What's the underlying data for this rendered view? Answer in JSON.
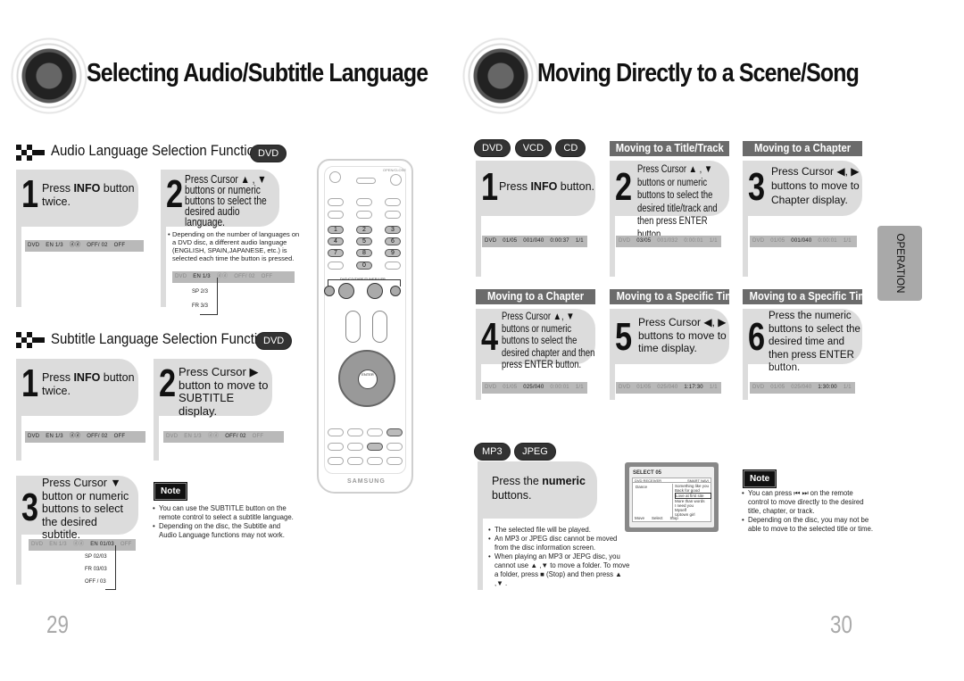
{
  "left_page": {
    "title": "Selecting Audio/Subtitle Language",
    "audio_section": {
      "heading": "Audio Language Selection Function",
      "badge": "DVD",
      "step1": {
        "num": "1",
        "pre": "Press ",
        "bold": "INFO",
        "post": " button twice."
      },
      "step2": {
        "num": "2",
        "text": "Press Cursor ▲ , ▼ buttons or numeric buttons to select the desired audio language."
      },
      "note": "Depending on the number of languages on a DVD disc, a different audio language (ENGLISH, SPAIN,JAPANESE, etc.) is selected each time the button is pressed.",
      "osd1": [
        "DVD",
        "EN 1/3",
        "ⓓⓓ",
        "OFF/ 02",
        "OFF"
      ],
      "osd2": [
        "DVD",
        "EN 1/3",
        "ⓓⓓ",
        "OFF/ 02",
        "OFF"
      ],
      "cycle": [
        "SP 2/3",
        "FR 3/3"
      ]
    },
    "subtitle_section": {
      "heading": "Subtitle Language Selection Function",
      "badge": "DVD",
      "step1": {
        "num": "1",
        "pre": "Press ",
        "bold": "INFO",
        "post": " button twice."
      },
      "step2": {
        "num": "2",
        "text": "Press Cursor ▶ button to move to SUBTITLE display."
      },
      "step3": {
        "num": "3",
        "text": "Press Cursor ▼ button or numeric buttons to select the desired subtitle."
      },
      "osd1": [
        "DVD",
        "EN 1/3",
        "ⓓⓓ",
        "OFF/ 02",
        "OFF"
      ],
      "osd2": [
        "DVD",
        "EN 1/3",
        "ⓓⓓ",
        "OFF/ 02",
        "OFF"
      ],
      "osd3": [
        "DVD",
        "EN 1/3",
        "ⓓⓓ",
        "EN 01/03",
        "OFF"
      ],
      "cycle": [
        "SP 02/03",
        "FR 03/03",
        "OFF / 03"
      ]
    },
    "note": {
      "label": "Note",
      "items": [
        "You can use the SUBTITLE button on the remote control to select a subtitle language.",
        "Depending on the disc, the Subtitle and Audio Language functions may not work."
      ]
    },
    "remote": {
      "brand": "SAMSUNG",
      "keys": [
        "1",
        "2",
        "3",
        "4",
        "5",
        "6",
        "7",
        "8",
        "9",
        "0"
      ],
      "label_top": "OPEN/CLOSE",
      "label_strip": "DVD/CD/TAPE/TUNER/USB",
      "enter": "ENTER"
    },
    "page_number": "29"
  },
  "right_page": {
    "title": "Moving Directly to a Scene/Song",
    "badges": [
      "DVD",
      "VCD",
      "CD"
    ],
    "step1": {
      "num": "1",
      "pre": "Press ",
      "bold": "INFO",
      "post": " button."
    },
    "title_track": {
      "heading": "Moving to a Title/Track",
      "step": {
        "num": "2",
        "text": "Press Cursor ▲ , ▼ buttons or numeric buttons to select the desired title/track and then press ENTER button."
      }
    },
    "chapter_a": {
      "heading": "Moving to a Chapter",
      "step": {
        "num": "3",
        "text": "Press Cursor ◀, ▶ buttons to move to Chapter display."
      }
    },
    "chapter_b": {
      "heading": "Moving to a Chapter",
      "step": {
        "num": "4",
        "text": "Press Cursor ▲, ▼ buttons or numeric buttons to select the desired chapter and then press ENTER button."
      }
    },
    "time_a": {
      "heading": "Moving to a Specific Time",
      "step": {
        "num": "5",
        "text": "Press Cursor ◀, ▶ buttons to move to time display."
      }
    },
    "time_b": {
      "heading": "Moving to a Specific Time",
      "step": {
        "num": "6",
        "text": "Press the numeric buttons to select the desired time and then press ENTER button."
      }
    },
    "osd": {
      "s1": [
        "DVD",
        "01/05",
        "001/040",
        "0:00:37",
        "1/1"
      ],
      "s2": [
        "DVD",
        "03/05",
        "001/032",
        "0:00:01",
        "1/1"
      ],
      "s3": [
        "DVD",
        "01/05",
        "001/040",
        "0:00:01",
        "1/1"
      ],
      "s4": [
        "DVD",
        "01/05",
        "025/040",
        "0:00:01",
        "1/1"
      ],
      "s5": [
        "DVD",
        "01/05",
        "025/040",
        "1:17:30",
        "1/1"
      ],
      "s6": [
        "DVD",
        "01/05",
        "025/040",
        "1:30:00",
        "1/1"
      ]
    },
    "mp3_badges": [
      "MP3",
      "JPEG"
    ],
    "mp3_step": {
      "pre": "Press the ",
      "bold": "numeric",
      "post": " buttons."
    },
    "mp3_bullets": [
      "The selected file will be played.",
      "An MP3 or JPEG disc cannot be moved from the disc information screen.",
      "When playing an MP3 or JEPG disc, you cannot use ▲ ,▼  to move a folder. To move a folder, press ■ (Stop) and then press ▲ ,▼ ."
    ],
    "screen": {
      "header": "SELECT  05",
      "sub_left": "DVD RECEIVER",
      "sub_right": "SMART NAVI",
      "folder": "Dance",
      "files": [
        "Something like you",
        "Back for good",
        "Love at first site",
        "More than words",
        "I need you",
        "Myself",
        "Uptown girl"
      ],
      "footer": [
        "Move",
        "Select",
        "Stop"
      ]
    },
    "note": {
      "label": "Note",
      "items": [
        "You can press ⏮ ⏭ on the remote control to move directly to the desired title, chapter, or track.",
        "Depending on the disc, you may not be able to move to the selected title or time."
      ]
    },
    "side_tab": "OPERATION",
    "page_number": "30"
  }
}
